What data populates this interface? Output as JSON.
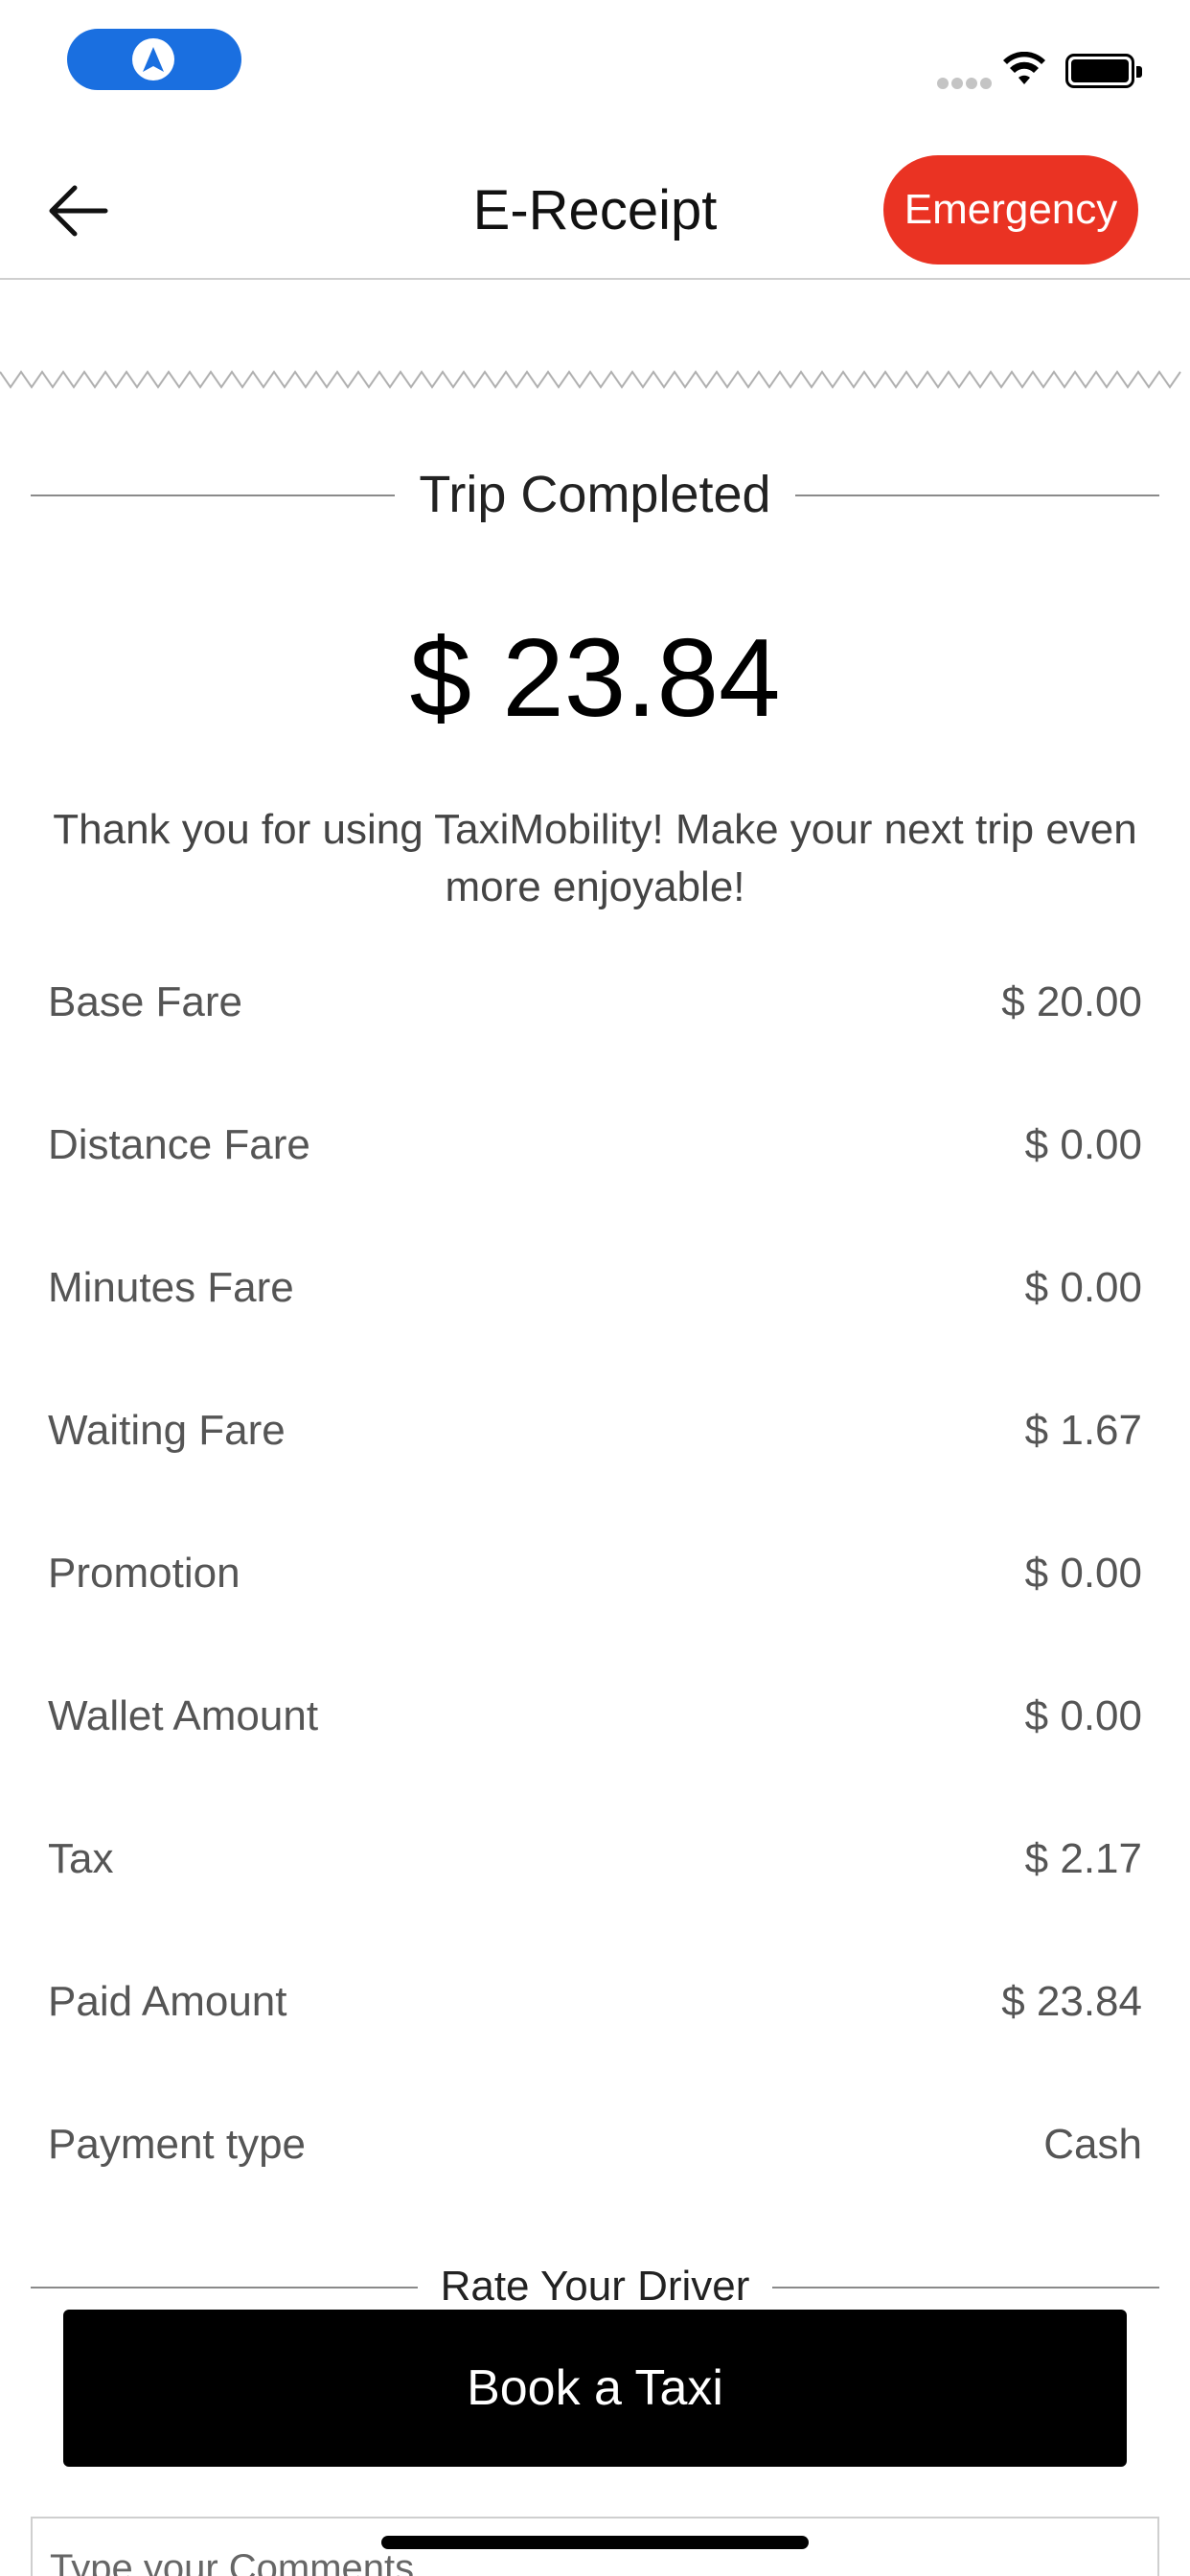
{
  "header": {
    "title": "E-Receipt",
    "emergency_label": "Emergency"
  },
  "trip": {
    "status_title": "Trip Completed",
    "total_amount": "$ 23.84",
    "thanks_message": "Thank you for using TaxiMobility! Make your next trip even more enjoyable!"
  },
  "fare_rows": [
    {
      "label": "Base Fare",
      "value": "$ 20.00"
    },
    {
      "label": "Distance Fare",
      "value": "$ 0.00"
    },
    {
      "label": "Minutes Fare",
      "value": "$ 0.00"
    },
    {
      "label": "Waiting Fare",
      "value": "$ 1.67"
    },
    {
      "label": "Promotion",
      "value": "$ 0.00"
    },
    {
      "label": "Wallet Amount",
      "value": "$ 0.00"
    },
    {
      "label": "Tax",
      "value": "$ 2.17"
    },
    {
      "label": "Paid Amount",
      "value": "$ 23.84"
    },
    {
      "label": "Payment type",
      "value": "Cash"
    }
  ],
  "rating": {
    "title": "Rate Your Driver"
  },
  "actions": {
    "book_label": "Book a Taxi"
  },
  "comments": {
    "placeholder": "Type your Comments"
  },
  "colors": {
    "emergency": "#ea3323",
    "nav_pill": "#1a6fe0",
    "book_button": "#000000"
  }
}
